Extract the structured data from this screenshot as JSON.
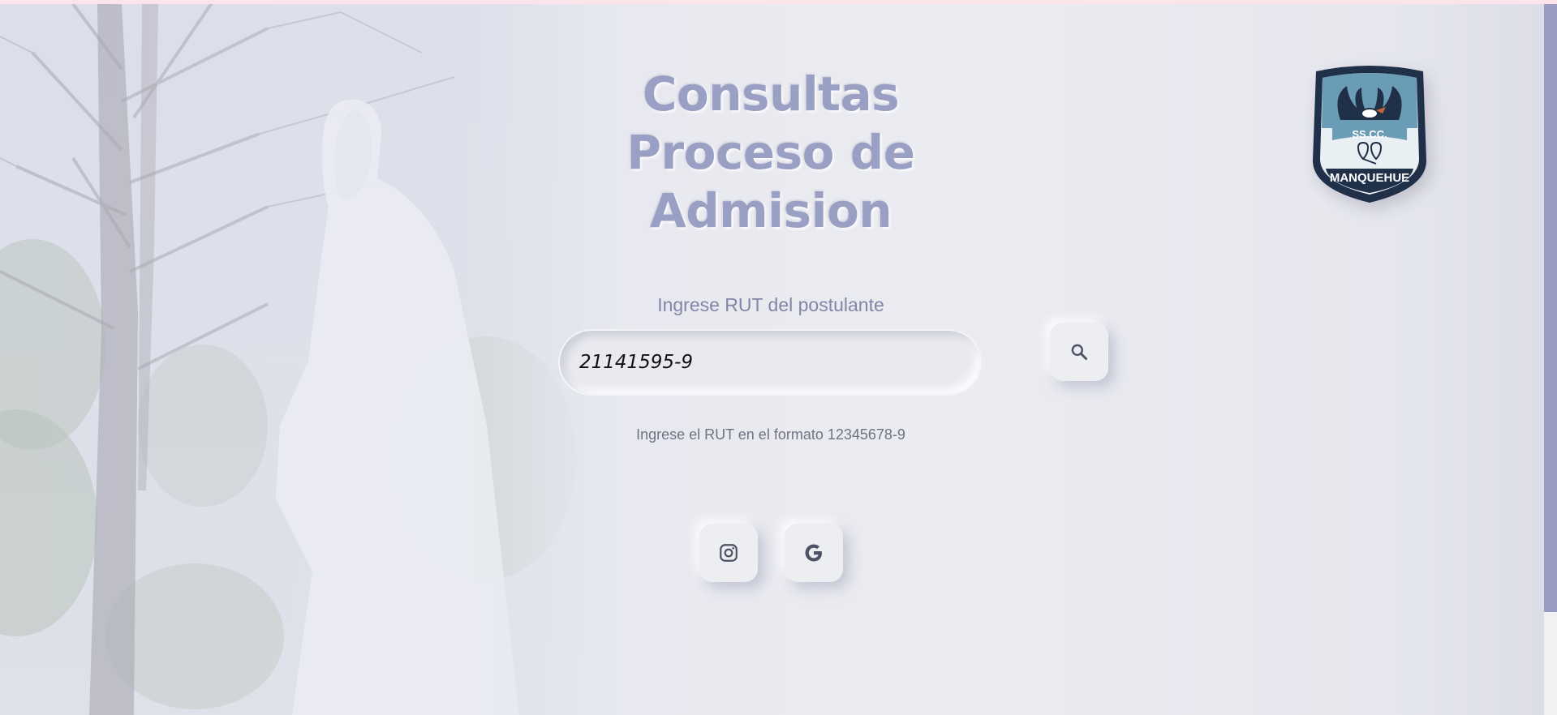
{
  "header": {
    "title_lines": [
      "Consultas",
      "Proceso de",
      "Admision"
    ]
  },
  "form": {
    "rut_label": "Ingrese RUT del postulante",
    "rut_value": "21141595-9",
    "hint": "Ingrese el RUT en el formato 12345678-9"
  },
  "icons": {
    "search": "search-icon",
    "instagram": "instagram-icon",
    "google": "google-icon"
  },
  "logo": {
    "badge_top_text": "SS.CC.",
    "badge_bottom_text": "MANQUEHUE"
  },
  "colors": {
    "title": "#9a9fc4",
    "scrollbar_thumb": "#9b9cc4",
    "logo_dark": "#1f3048",
    "logo_blue": "#6a9db5"
  }
}
